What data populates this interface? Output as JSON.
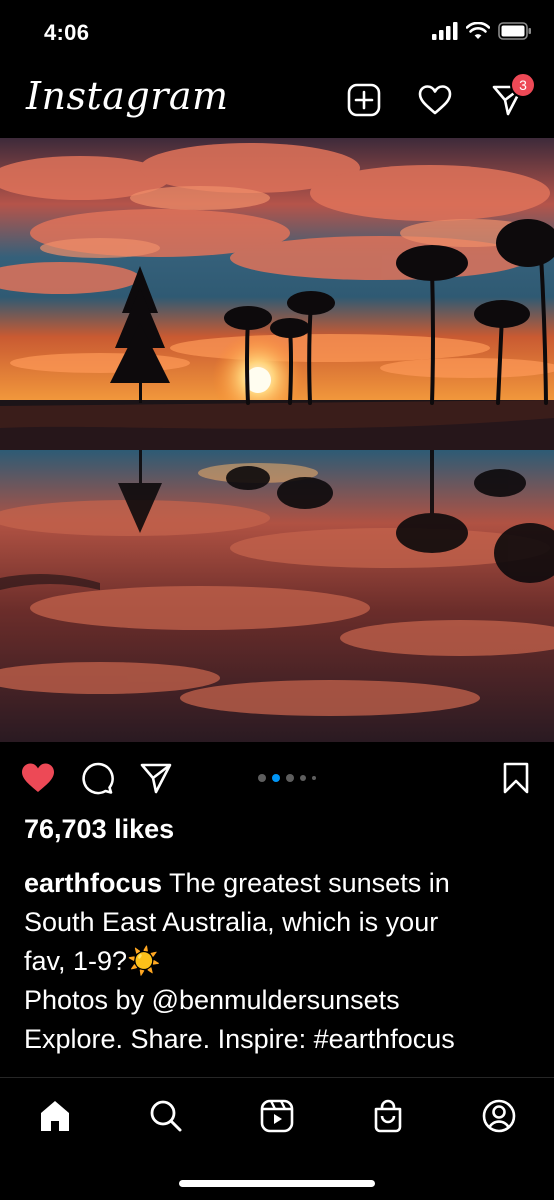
{
  "status_bar": {
    "time": "4:06",
    "icons": [
      "signal-icon",
      "wifi-icon",
      "battery-icon"
    ]
  },
  "header": {
    "logo": "Instagram",
    "actions": [
      "new-post-icon",
      "heart-icon",
      "direct-message-icon"
    ],
    "dm_badge": "3"
  },
  "post": {
    "image": "sunset-with-palm-trees-reflected-in-water",
    "liked": true,
    "carousel": {
      "total_dots": 5,
      "active_index": 1
    },
    "likes": "76,703 likes",
    "caption": {
      "username": "earthfocus",
      "text_line1": " The greatest sunsets in",
      "text_line2": "South East Australia, which is your",
      "text_line3": "fav, 1-9?",
      "emoji": "☀️",
      "line4": "Photos by @benmuldersunsets",
      "line5": "Explore. Share. Inspire: #earthfocus"
    }
  },
  "bottom_nav": {
    "items": [
      "home-icon",
      "search-icon",
      "reels-icon",
      "shop-icon",
      "profile-icon"
    ],
    "active": "home-icon"
  },
  "colors": {
    "background": "#000000",
    "text": "#ffffff",
    "like_red": "#ed4956",
    "active_dot": "#0095f6",
    "inactive_dot": "#5e5e5e"
  }
}
